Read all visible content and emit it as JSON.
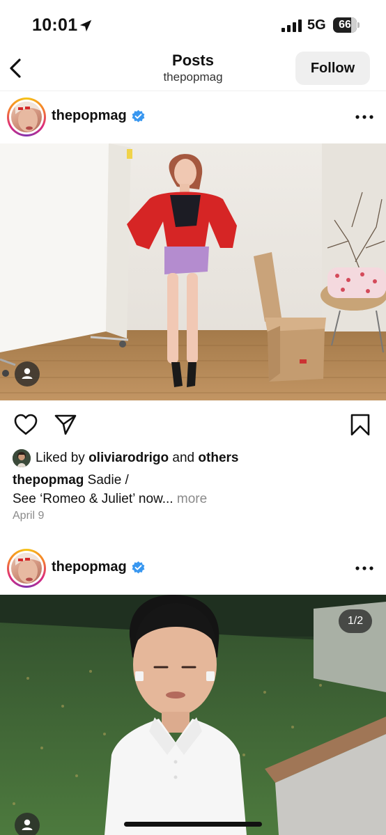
{
  "status_bar": {
    "time": "10:01",
    "network": "5G",
    "battery": "66",
    "icons": [
      "location-arrow-icon",
      "signal-icon",
      "battery-icon"
    ]
  },
  "nav": {
    "title": "Posts",
    "subtitle": "thepopmag",
    "follow_label": "Follow",
    "icons": [
      "back-chevron-icon"
    ]
  },
  "posts": [
    {
      "username": "thepopmag",
      "verified": true,
      "icons": [
        "verified-badge-icon",
        "more-options-icon",
        "tagged-user-icon"
      ],
      "actions": [
        "heart-icon",
        "share-icon",
        "bookmark-icon"
      ],
      "likes": {
        "prefix": "Liked by",
        "user": "oliviarodrigo",
        "joiner": "and",
        "others": "others"
      },
      "caption": {
        "username": "thepopmag",
        "line1": "Sadie /",
        "line2": "See ‘Romeo & Juliet’ now...",
        "more": "more"
      },
      "date": "April 9"
    },
    {
      "username": "thepopmag",
      "verified": true,
      "carousel_counter": "1/2",
      "icons": [
        "verified-badge-icon",
        "more-options-icon",
        "tagged-user-icon"
      ]
    }
  ],
  "colors": {
    "verified_blue": "#3897f0",
    "follow_bg": "#efefef",
    "muted_text": "#8a8a8a"
  }
}
